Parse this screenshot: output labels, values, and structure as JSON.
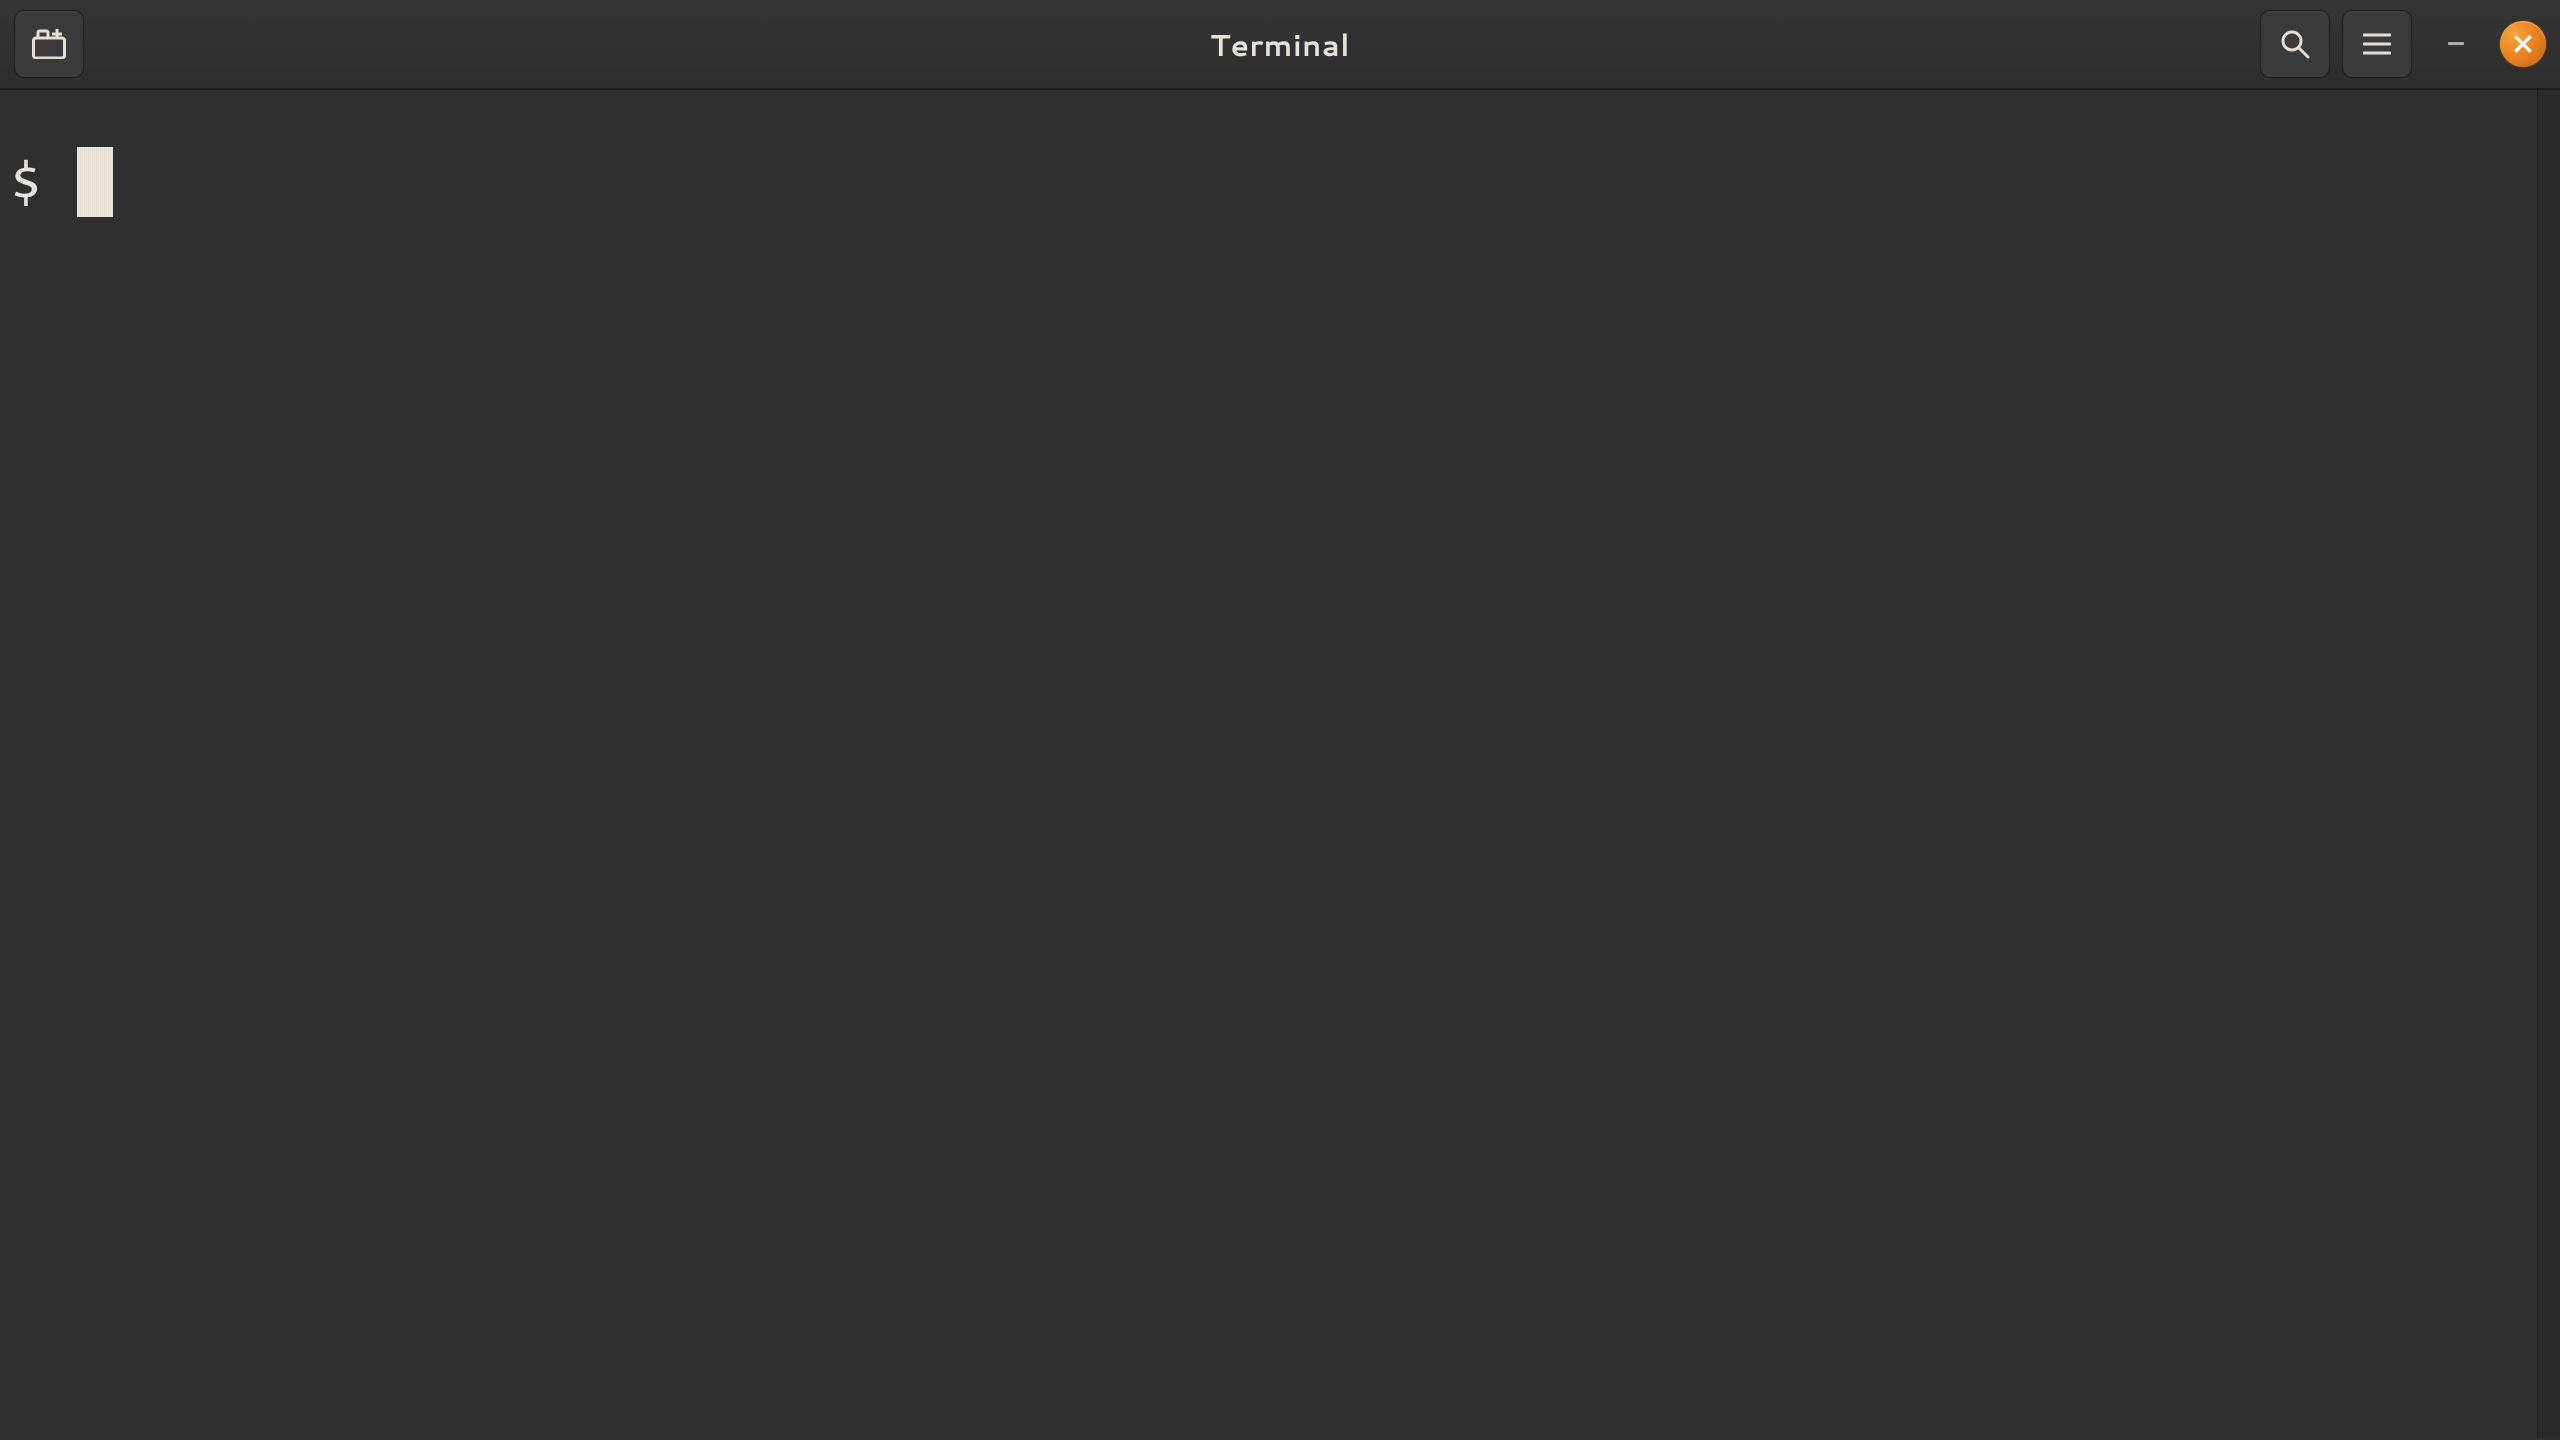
{
  "header": {
    "title": "Terminal",
    "new_tab_icon": "new-tab",
    "search_icon": "search",
    "menu_icon": "hamburger",
    "minimize_label": "–",
    "close_icon": "close"
  },
  "terminal": {
    "prompt": "$",
    "input_value": ""
  },
  "colors": {
    "bg": "#2f2f2f",
    "fg": "#e9e3da",
    "accent": "#e77f1f"
  }
}
